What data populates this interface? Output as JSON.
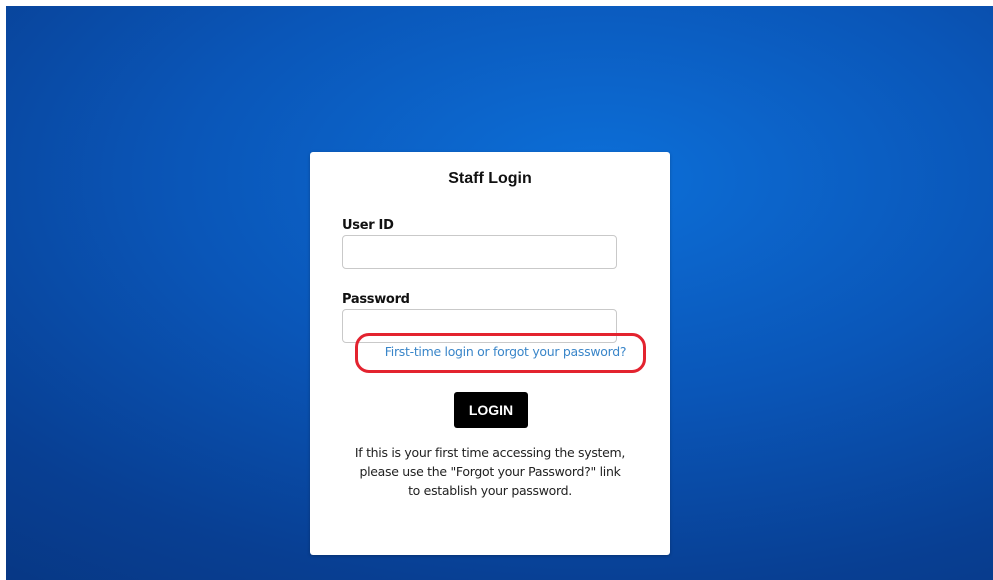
{
  "login": {
    "title": "Staff Login",
    "user_id_label": "User ID",
    "user_id_value": "",
    "password_label": "Password",
    "password_value": "",
    "forgot_link": "First-time login or forgot your password?",
    "login_button": "LOGIN",
    "info_lines": [
      "If this is your first time accessing the system,",
      "please use the \"Forgot your Password?\" link",
      "to establish your password."
    ]
  },
  "colors": {
    "background_gradient": [
      "#0d6fd8",
      "#062f74"
    ],
    "card": "#ffffff",
    "link": "#3a86c9",
    "highlight_ring": "#e3232f",
    "button": "#000000"
  }
}
